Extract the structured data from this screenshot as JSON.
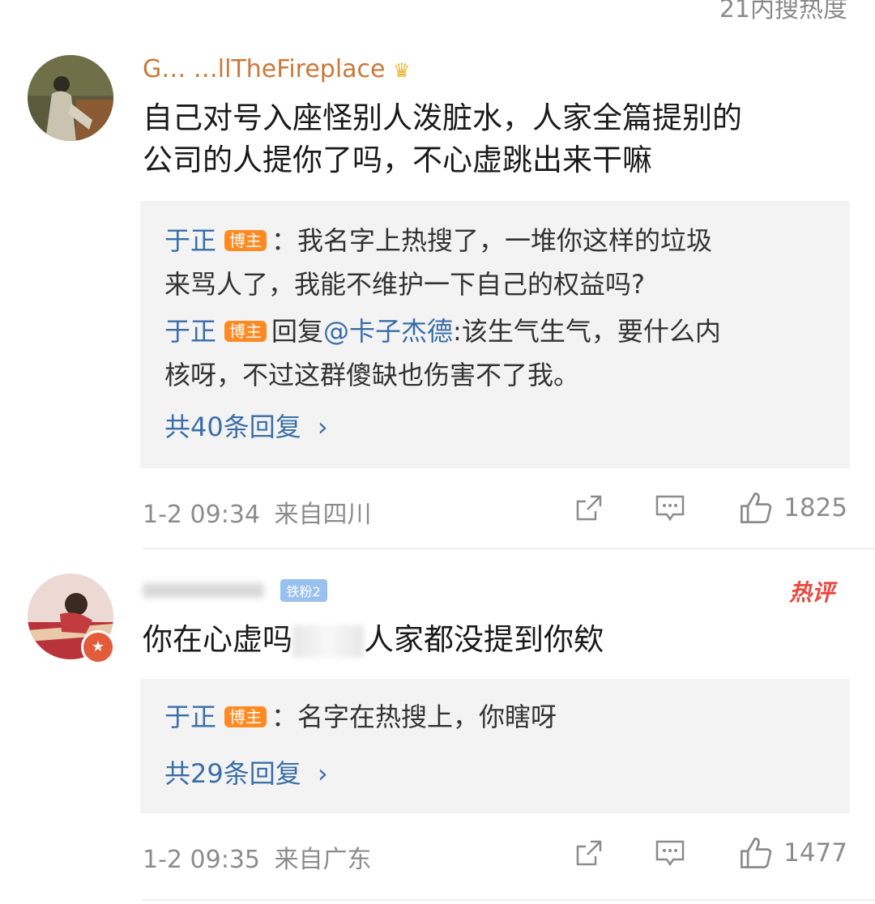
{
  "top_fragment": "21内搜热度",
  "comments": [
    {
      "username": "G… …llTheFireplace",
      "text_line1": "自己对号入座怪别人泼脏水，人家全篇提别的",
      "text_line2": "公司的人提你了吗，不心虚跳出来干嘛",
      "replies": [
        {
          "name": "于正",
          "badge": "博主",
          "sep": "：",
          "line1": "我名字上热搜了，一堆你这样的垃圾",
          "line2": "来骂人了，我能不维护一下自己的权益吗?"
        },
        {
          "name": "于正",
          "badge": "博主",
          "prefix": "回复",
          "mention": "@卡子杰德",
          "sep": ":",
          "line1": "该生气生气，要什么内",
          "line2": "核呀，不过这群傻缺也伤害不了我。"
        }
      ],
      "more_replies": "共40条回复",
      "time": "1-2 09:34",
      "location": "来自四川",
      "likes": "1825"
    },
    {
      "vip_label": "铁粉2",
      "hot_label": "热评",
      "text_part1": "你在心虚吗",
      "text_part2": "人家都没提到你欸",
      "replies": [
        {
          "name": "于正",
          "badge": "博主",
          "sep": "：",
          "line1": "名字在热搜上，你瞎呀"
        }
      ],
      "more_replies": "共29条回复",
      "time": "1-2 09:35",
      "location": "来自广东",
      "likes": "1477"
    }
  ],
  "icons": {
    "share": "share-icon",
    "comment": "comment-icon",
    "like": "like-icon",
    "chevron": "chevron-right-icon"
  },
  "colors": {
    "link": "#3a6ea8",
    "badge": "#ff8a22",
    "hot": "#e8483e",
    "meta": "#8c8c8c",
    "reply_bg": "#f3f3f3"
  }
}
